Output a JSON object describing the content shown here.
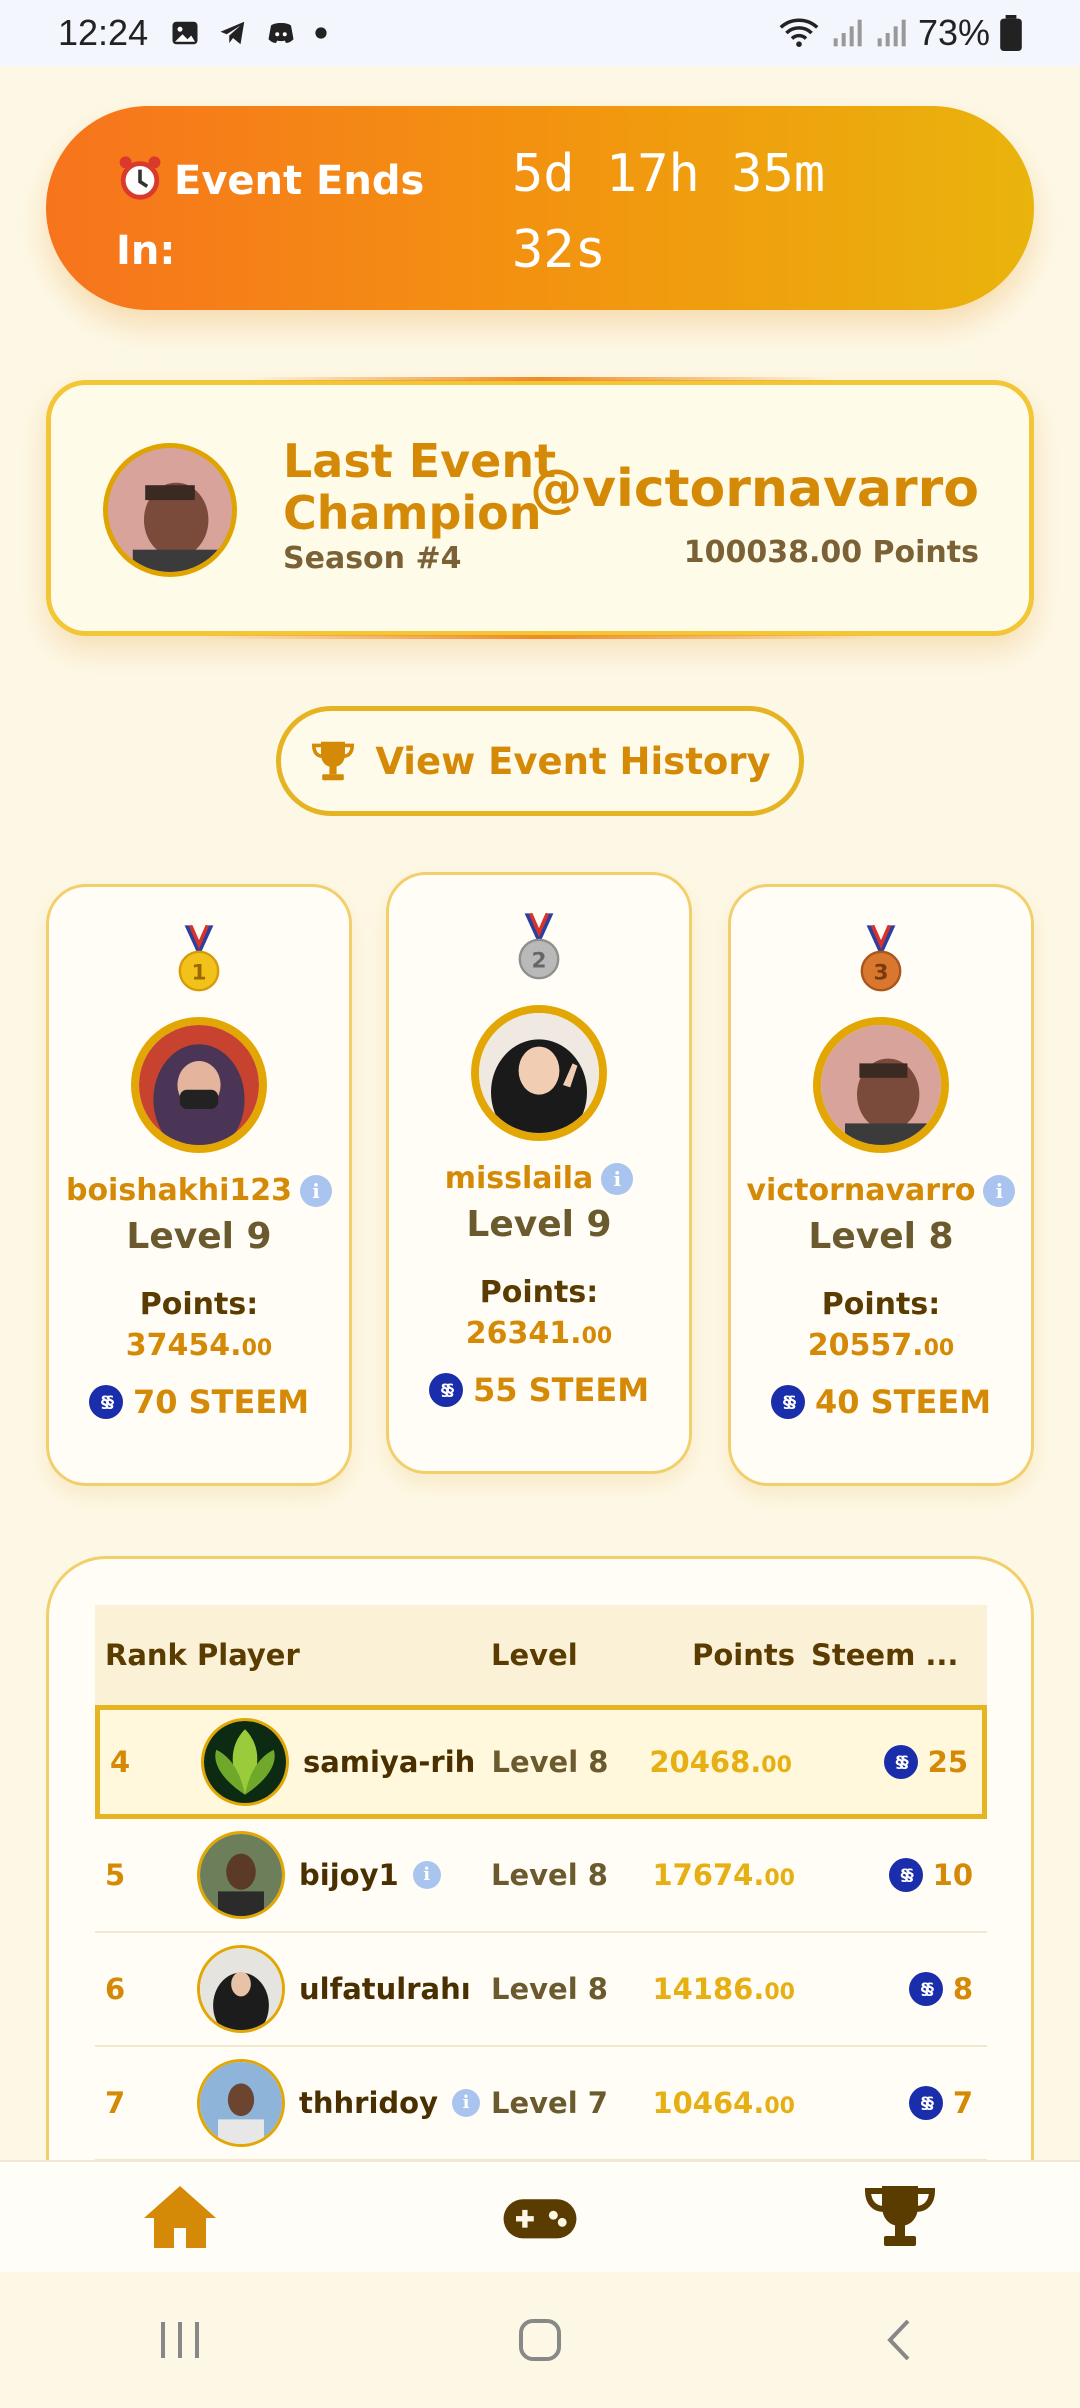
{
  "status_bar": {
    "time": "12:24",
    "battery": "73%"
  },
  "countdown": {
    "label": "Event Ends In:",
    "time": "5d 17h 35m 32s"
  },
  "champion": {
    "title_line1": "Last Event",
    "title_line2": "Champion",
    "season": "Season #4",
    "username": "@victornavarro",
    "points": "100038.00 Points"
  },
  "history_button": {
    "label": "View Event History"
  },
  "podium": [
    {
      "username": "boishakhi123",
      "level": "Level 9",
      "points_label": "Points:",
      "points_int": "37454.",
      "points_dec": "00",
      "reward": "70 STEEM",
      "medal_color": "#f2c21a"
    },
    {
      "username": "misslaila",
      "level": "Level 9",
      "points_label": "Points:",
      "points_int": "26341.",
      "points_dec": "00",
      "reward": "55 STEEM",
      "medal_color": "#b9b9b9"
    },
    {
      "username": "victornavarro",
      "level": "Level 8",
      "points_label": "Points:",
      "points_int": "20557.",
      "points_dec": "00",
      "reward": "40 STEEM",
      "medal_color": "#d9772e"
    }
  ],
  "leaderboard": {
    "headers": {
      "rank": "Rank",
      "player": "Player",
      "level": "Level",
      "points": "Points",
      "steem": "Steem ..."
    },
    "rows": [
      {
        "rank": "4",
        "player": "samiya-rih",
        "level": "Level 8",
        "points_int": "20468.",
        "points_dec": "00",
        "steem": "25"
      },
      {
        "rank": "5",
        "player": "bijoy1",
        "level": "Level 8",
        "points_int": "17674.",
        "points_dec": "00",
        "steem": "10"
      },
      {
        "rank": "6",
        "player": "ulfatulrahı",
        "level": "Level 8",
        "points_int": "14186.",
        "points_dec": "00",
        "steem": "8"
      },
      {
        "rank": "7",
        "player": "thhridoy",
        "level": "Level 7",
        "points_int": "10464.",
        "points_dec": "00",
        "steem": "7"
      }
    ]
  },
  "colors": {
    "accent": "#d48a06",
    "gold_border": "#e6b423",
    "banner_start": "#f7741d",
    "banner_end": "#e9b40c",
    "nav_active": "#d48a06",
    "nav_inactive": "#5a3b00"
  },
  "icons": {
    "home": "home-icon",
    "games": "gamepad-icon",
    "leaderboard": "trophy-icon"
  }
}
